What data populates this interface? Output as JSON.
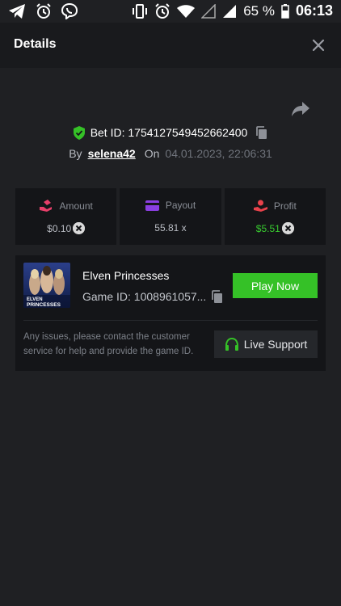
{
  "statusbar": {
    "battery": "65 %",
    "time": "06:13",
    "icons": [
      "telegram-icon",
      "alarm-icon",
      "viber-icon",
      "vibrate-icon",
      "alarm-icon",
      "wifi-icon",
      "signal-icon",
      "signal-icon",
      "battery-icon"
    ]
  },
  "header": {
    "title": "Details",
    "close_icon": "close-icon"
  },
  "bet": {
    "id_label": "Bet ID: 1754127549452662400",
    "by_label": "By",
    "username": "selena42",
    "on_label": "On",
    "datetime": "04.01.2023, 22:06:31"
  },
  "stats": {
    "amount": {
      "label": "Amount",
      "value": "$0.10"
    },
    "payout": {
      "label": "Payout",
      "value": "55.81 x"
    },
    "profit": {
      "label": "Profit",
      "value": "$5.51"
    }
  },
  "game": {
    "name": "Elven Princesses",
    "id_label": "Game ID: 1008961057...",
    "thumb_text_1": "ELVEN",
    "thumb_text_2": "PRINCESSES",
    "play_label": "Play Now",
    "support_text": "Any issues, please contact the customer service for help and provide the game ID.",
    "support_label": "Live Support"
  },
  "colors": {
    "accent_green": "#35c127",
    "profit_green": "#38cc2f",
    "amount_pink": "#e83f6a",
    "payout_purple": "#8a3fe0",
    "profit_red": "#e8424b"
  }
}
